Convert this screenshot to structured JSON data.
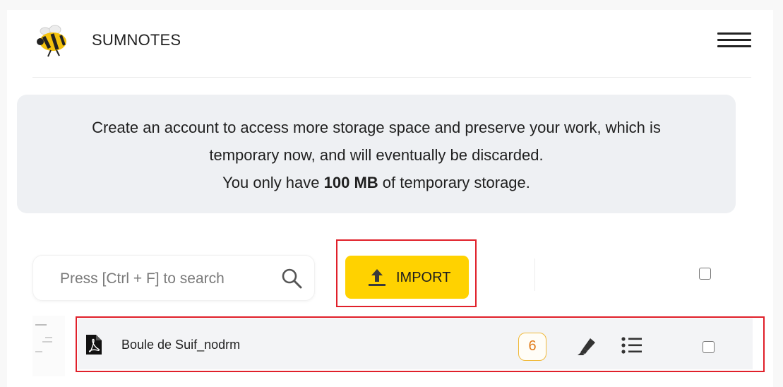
{
  "header": {
    "app_title": "SUMNOTES",
    "logo_icon": "bee-logo-icon",
    "menu_icon": "hamburger-menu-icon"
  },
  "banner": {
    "line1": "Create an account to access more storage space and preserve your work, which is",
    "line2": "temporary now, and will eventually be discarded.",
    "line3_before": "You only have ",
    "line3_bold": "100 MB",
    "line3_after": " of temporary storage."
  },
  "toolbar": {
    "search_placeholder": "Press [Ctrl + F] to search",
    "search_icon": "search-icon",
    "import_label": "IMPORT",
    "import_icon": "upload-icon",
    "accent_color": "#ffd200"
  },
  "files": [
    {
      "name": "Boule de Suif_nodrm",
      "type_icon": "pdf-file-icon",
      "count": "6",
      "actions": [
        "highlighter-icon",
        "list-icon"
      ]
    }
  ],
  "highlight_color": "#e0202a"
}
